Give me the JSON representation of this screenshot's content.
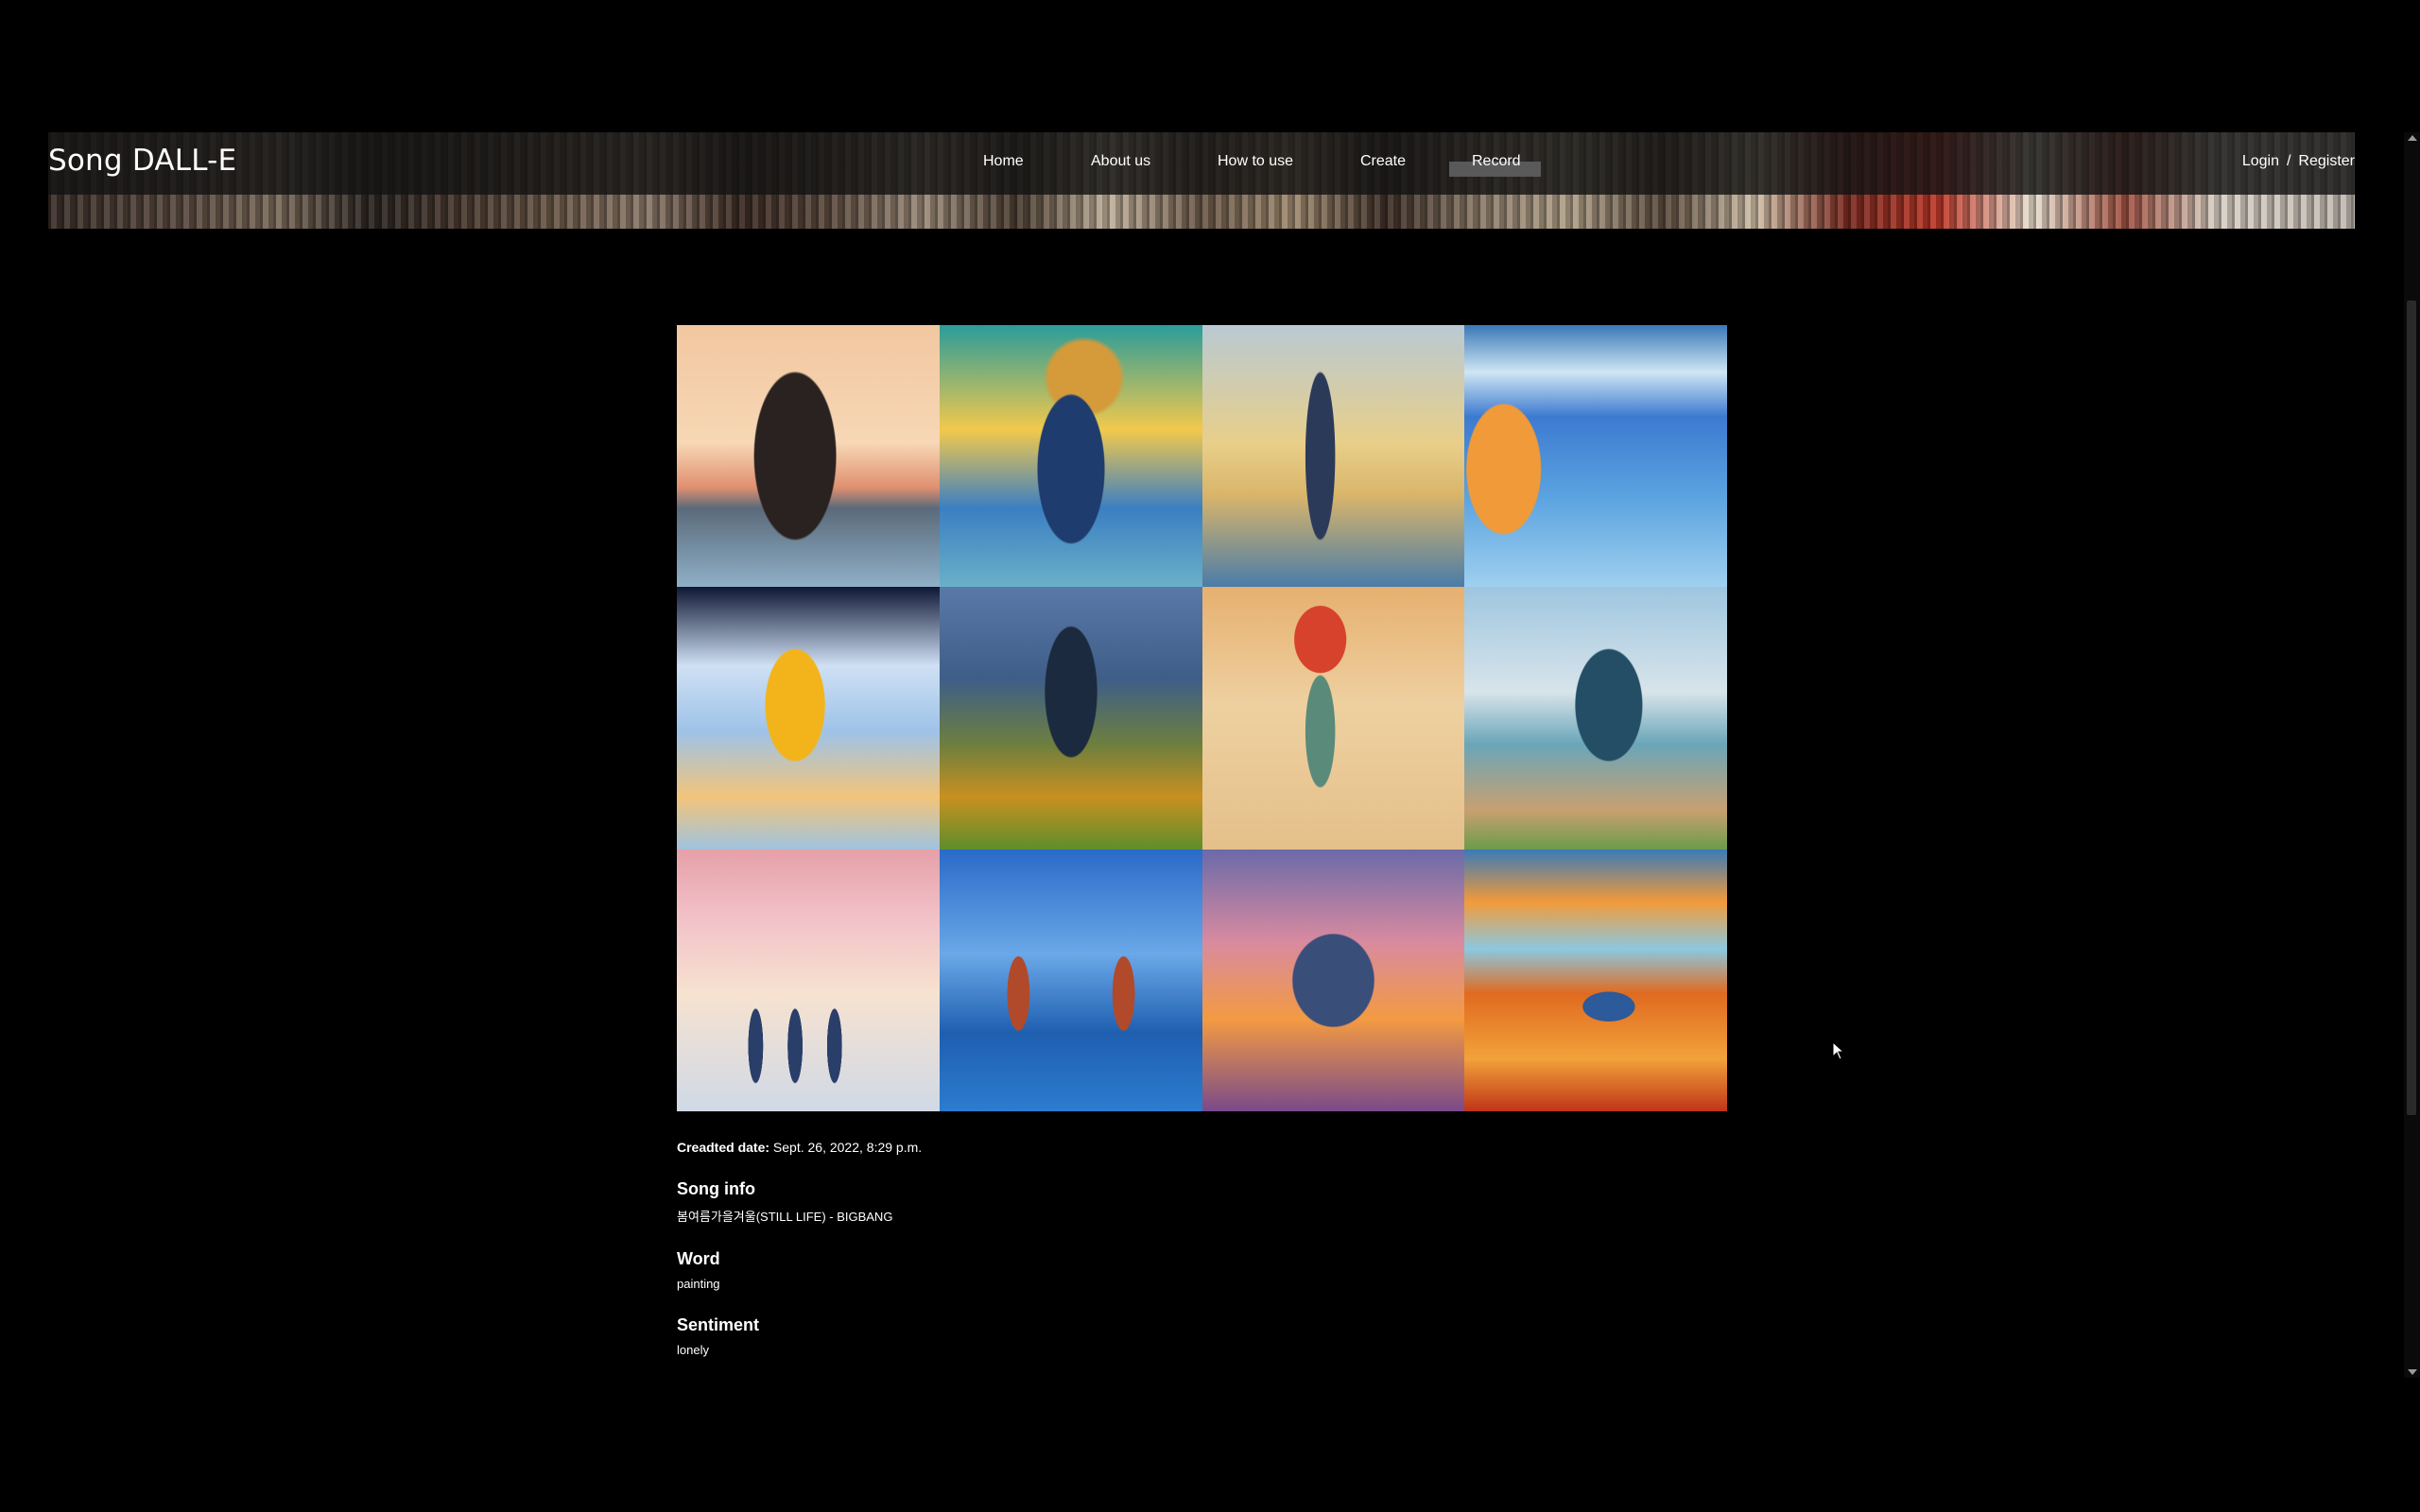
{
  "brand": "Song DALL-E",
  "nav": {
    "links": [
      "Home",
      "About us",
      "How to use",
      "Create",
      "Record"
    ],
    "active": "Record"
  },
  "auth": {
    "login": "Login",
    "separator": "/",
    "register": "Register"
  },
  "gallery": {
    "count": 12
  },
  "created": {
    "label": "Creadted date:",
    "value": "Sept. 26, 2022, 8:29 p.m."
  },
  "song_info": {
    "title": "Song info",
    "value": "봄여름가을겨울(STILL LIFE) - BIGBANG"
  },
  "word": {
    "title": "Word",
    "value": "painting"
  },
  "sentiment": {
    "title": "Sentiment",
    "value": "lonely"
  }
}
